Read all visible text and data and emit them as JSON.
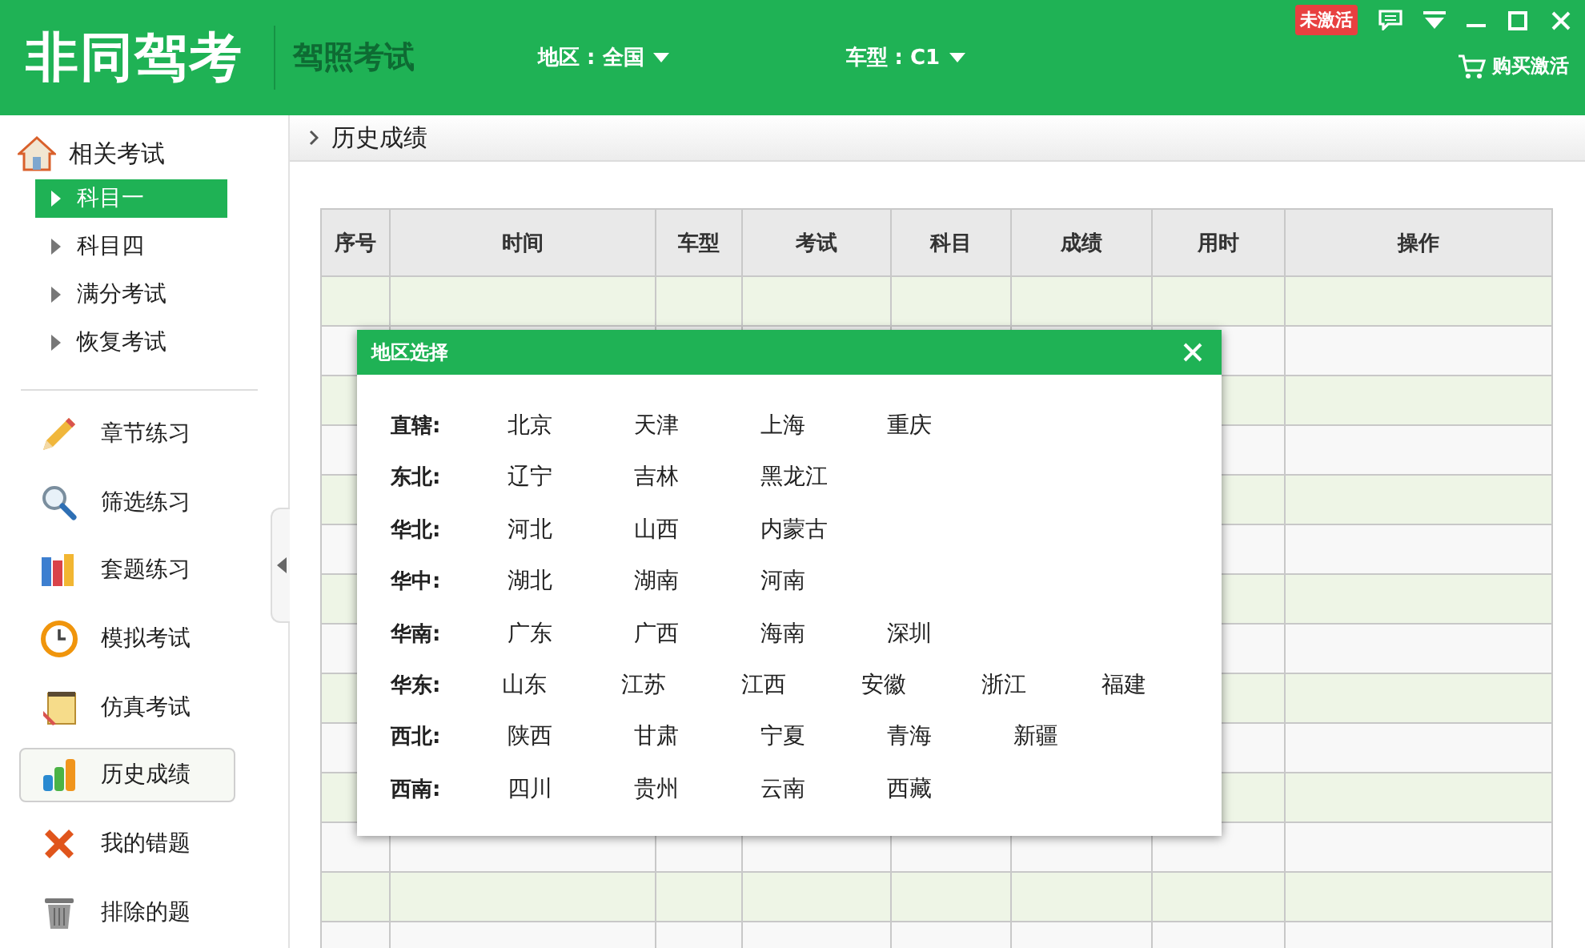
{
  "header": {
    "logo": "非同驾考",
    "subtitle": "驾照考试",
    "badge": "未激活",
    "buy": "购买激活"
  },
  "filters": [
    {
      "label": "地区 : 全国"
    },
    {
      "label": "车型 : C1"
    }
  ],
  "sidebar": {
    "group": {
      "label": "相关考试",
      "items": [
        {
          "label": "科目一",
          "selected": true
        },
        {
          "label": "科目四",
          "selected": false
        },
        {
          "label": "满分考试",
          "selected": false
        },
        {
          "label": "恢复考试",
          "selected": false
        }
      ]
    },
    "items": [
      {
        "label": "章节练习",
        "kind": "pencil",
        "selected": false
      },
      {
        "label": "筛选练习",
        "kind": "search",
        "selected": false
      },
      {
        "label": "套题练习",
        "kind": "books",
        "selected": false
      },
      {
        "label": "模拟考试",
        "kind": "clock",
        "selected": false
      },
      {
        "label": "仿真考试",
        "kind": "notepad",
        "selected": false
      },
      {
        "label": "历史成绩",
        "kind": "chart",
        "selected": true
      },
      {
        "label": "我的错题",
        "kind": "cross",
        "selected": false
      },
      {
        "label": "排除的题",
        "kind": "trash",
        "selected": false
      }
    ]
  },
  "breadcrumb": "历史成绩",
  "table": {
    "columns": [
      "序号",
      "时间",
      "车型",
      "考试",
      "科目",
      "成绩",
      "用时",
      "操作"
    ]
  },
  "dialog": {
    "title": "地区选择",
    "groups": [
      {
        "label": "直辖:",
        "regions": [
          "北京",
          "天津",
          "上海",
          "重庆"
        ]
      },
      {
        "label": "东北:",
        "regions": [
          "辽宁",
          "吉林",
          "黑龙江"
        ]
      },
      {
        "label": "华北:",
        "regions": [
          "河北",
          "山西",
          "内蒙古"
        ]
      },
      {
        "label": "华中:",
        "regions": [
          "湖北",
          "湖南",
          "河南"
        ]
      },
      {
        "label": "华南:",
        "regions": [
          "广东",
          "广西",
          "海南",
          "深圳"
        ]
      },
      {
        "label": "华东:",
        "regions": [
          "山东",
          "江苏",
          "江西",
          "安徽",
          "浙江",
          "福建"
        ]
      },
      {
        "label": "西北:",
        "regions": [
          "陕西",
          "甘肃",
          "宁夏",
          "青海",
          "新疆"
        ]
      },
      {
        "label": "西南:",
        "regions": [
          "四川",
          "贵州",
          "云南",
          "西藏"
        ]
      }
    ]
  }
}
